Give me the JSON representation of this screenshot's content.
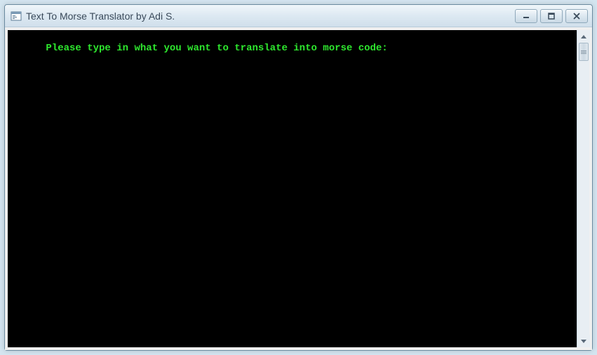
{
  "window": {
    "title": "Text To Morse Translator by Adi S."
  },
  "console": {
    "prompt": "Please type in what you want to translate into morse code:"
  }
}
